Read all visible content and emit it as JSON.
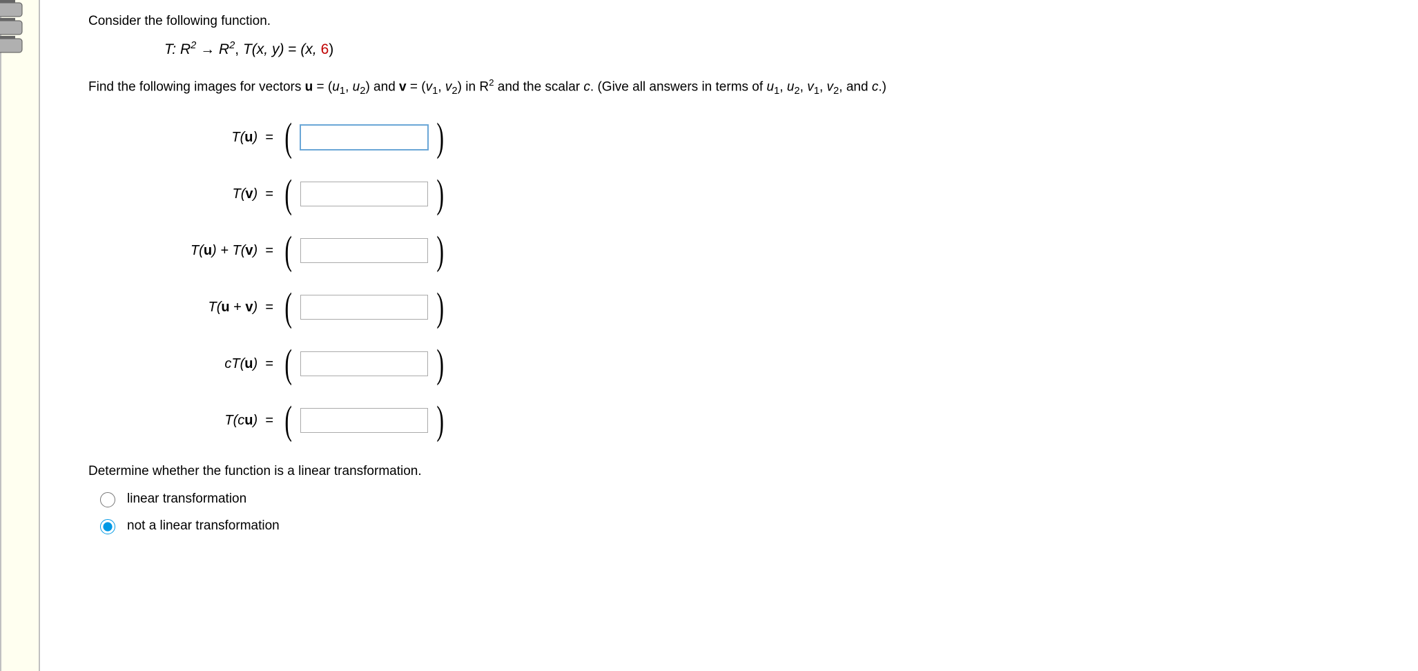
{
  "question": {
    "intro": "Consider the following function.",
    "function_prefix": "T: R",
    "function_arrow": " → R",
    "function_exponent": "2",
    "function_def_sep": ", T(x, y) = (x, ",
    "function_constant": "6",
    "function_close": ")",
    "prompt_a": "Find the following images for vectors ",
    "u_bold": "u",
    "eq_open": " = (",
    "u1": "u",
    "comma_sp": ", ",
    "u2": "u",
    "close_and": ") and ",
    "v_bold": "v",
    "v1": "v",
    "v2": "v",
    "in_R": ") in R",
    "prompt_b": " and the scalar ",
    "c_var": "c",
    "prompt_c": ". (Give all answers in terms of ",
    "and_word": " and ",
    "period_close": ".)",
    "determine": "Determine whether the function is a linear transformation."
  },
  "rows": {
    "r1": {
      "label_T": "T(",
      "label_arg": "u",
      "label_close": ")"
    },
    "r2": {
      "label_T": "T(",
      "label_arg": "v",
      "label_close": ")"
    },
    "r3": {
      "label_a": "T(",
      "arg_a": "u",
      "mid": ") + T(",
      "arg_b": "v",
      "close": ")"
    },
    "r4": {
      "label_a": "T(",
      "arg_a": "u",
      "mid": " + ",
      "arg_b": "v",
      "close": ")"
    },
    "r5": {
      "pre": "cT(",
      "arg": "u",
      "close": ")"
    },
    "r6": {
      "pre": "T(c",
      "arg": "u",
      "close": ")"
    }
  },
  "inputs": {
    "tu": "",
    "tv": "",
    "tu_plus_tv": "",
    "tu_v": "",
    "ctu": "",
    "tcu": ""
  },
  "radio": {
    "opt1": "linear transformation",
    "opt2": "not a linear transformation",
    "selected_index": 1
  }
}
